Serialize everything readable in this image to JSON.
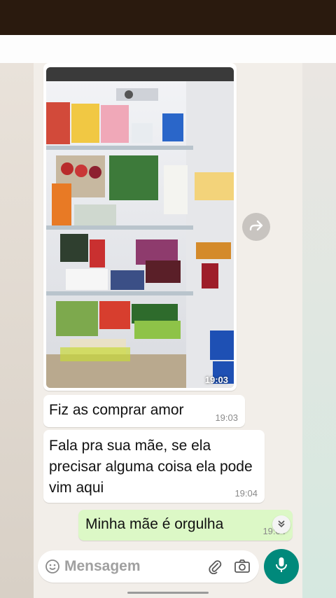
{
  "media_message": {
    "time": "19:03",
    "image_description": "fridge-photo"
  },
  "messages": [
    {
      "text": "Fiz as comprar amor",
      "time": "19:03",
      "direction": "incoming"
    },
    {
      "text": "Fala pra sua mãe, se ela precisar alguma coisa ela pode vim aqui",
      "time": "19:04",
      "direction": "incoming"
    },
    {
      "text": "Minha mãe é orgulha",
      "time": "19:04",
      "direction": "outgoing"
    }
  ],
  "composer": {
    "placeholder": "Mensagem"
  },
  "icons": {
    "forward": "forward-icon",
    "emoji": "emoji-icon",
    "attach": "paperclip-icon",
    "camera": "camera-icon",
    "mic": "mic-icon",
    "scroll": "double-chevron-down-icon"
  },
  "colors": {
    "outgoing_bubble": "#dcf8c6",
    "incoming_bubble": "#ffffff",
    "mic_button": "#00897b",
    "chat_background": "#f2eee9"
  }
}
